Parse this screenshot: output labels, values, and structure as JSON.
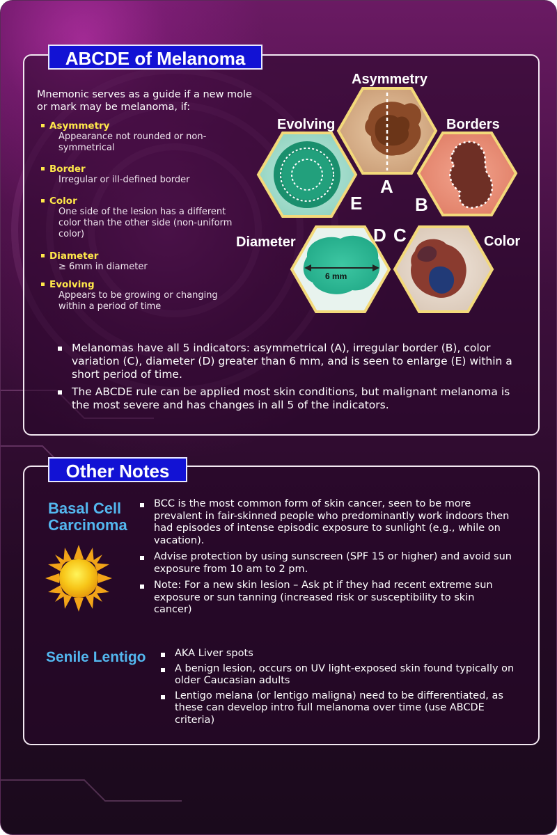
{
  "abcde": {
    "title": "ABCDE of Melanoma",
    "intro": "Mnemonic serves as a guide if a new mole or mark may be melanoma, if:",
    "criteria": [
      {
        "name": "Asymmetry",
        "desc": "Appearance not rounded or non-symmetrical"
      },
      {
        "name": "Border",
        "desc": "Irregular or ill-defined border"
      },
      {
        "name": "Color",
        "desc": "One side of the lesion has a different color than the other side (non-uniform color)"
      },
      {
        "name": "Diameter",
        "desc": "≥ 6mm in diameter"
      },
      {
        "name": "Evolving",
        "desc": "Appears to be growing or changing within a period of time"
      }
    ],
    "diagram": {
      "asymmetry_label": "Asymmetry",
      "borders_label": "Borders",
      "evolving_label": "Evolving",
      "diameter_label": "Diameter",
      "color_label": "Color",
      "letter_a": "A",
      "letter_b": "B",
      "letter_c": "C",
      "letter_d": "D",
      "letter_e": "E",
      "measure": "6 mm"
    },
    "bullets": [
      "Melanomas have all 5 indicators: asymmetrical (A), irregular border (B), color variation (C), diameter (D) greater than 6 mm, and is seen to enlarge (E) within a short period of time.",
      "The ABCDE rule can be applied most skin conditions, but malignant melanoma is the most severe and has changes in all 5 of the indicators."
    ]
  },
  "other": {
    "title": "Other Notes",
    "bcc_title": "Basal Cell Carcinoma",
    "bcc_bullets": [
      "BCC is the most common form of skin cancer, seen to be more prevalent in fair-skinned people who predominantly work indoors then had episodes of intense episodic exposure to sunlight (e.g., while on vacation).",
      "Advise protection by using sunscreen (SPF 15 or higher) and avoid sun exposure from 10 am to 2 pm.",
      "Note: For a new skin lesion – Ask pt if they had recent extreme sun exposure or sun tanning (increased risk or susceptibility to skin cancer)"
    ],
    "lentigo_title": "Senile Lentigo",
    "lentigo_bullets": [
      "AKA Liver spots",
      "A benign lesion, occurs on UV light-exposed skin found typically on older Caucasian adults",
      "Lentigo melana (or lentigo maligna) need to be differentiated, as these can develop intro full melanoma over time (use ABCDE criteria)"
    ]
  },
  "colors": {
    "title_tab": "#1212d4",
    "criteria_name": "#ffe84a",
    "subheading": "#53b7ef",
    "hex_border": "#f3d97a"
  }
}
